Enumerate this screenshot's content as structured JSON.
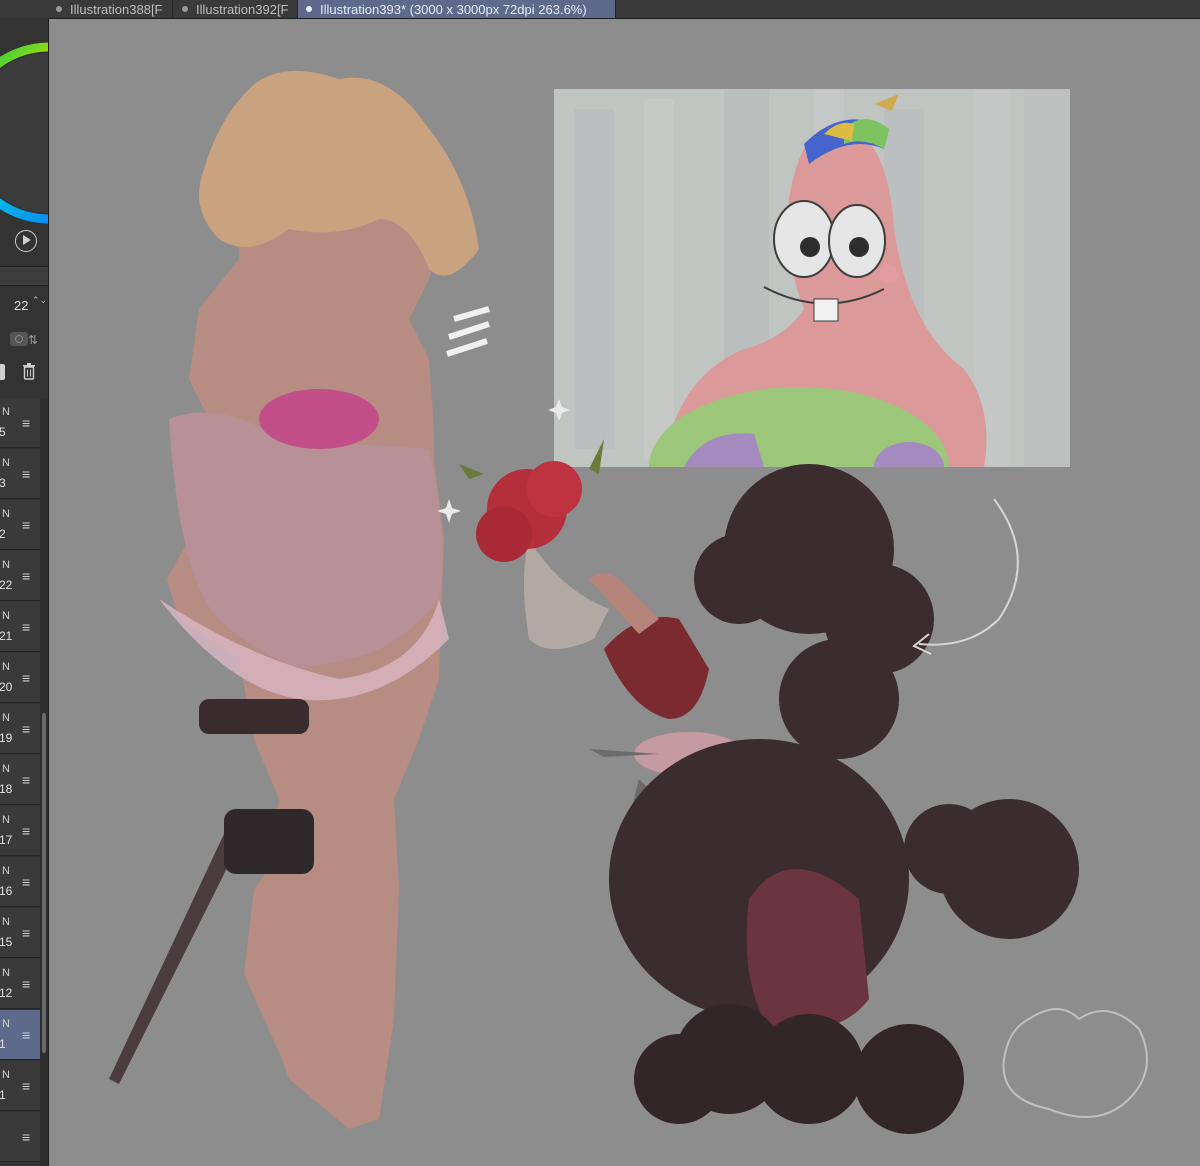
{
  "tabs": [
    {
      "label": "Illustration388[F",
      "active": false
    },
    {
      "label": "Illustration392[F",
      "active": false
    },
    {
      "label": "Illustration393* (3000 x 3000px 72dpi 263.6%)",
      "active": true
    }
  ],
  "toolbar": {
    "size_value": "22",
    "size_stepper": "⌃⌄"
  },
  "layers": [
    {
      "tag": "N",
      "num": "5",
      "menu": "≡",
      "selected": false
    },
    {
      "tag": "N",
      "num": "3",
      "menu": "≡",
      "selected": false
    },
    {
      "tag": "N",
      "num": "2",
      "menu": "≡",
      "selected": false
    },
    {
      "tag": "N",
      "num": "22",
      "menu": "≡",
      "selected": false
    },
    {
      "tag": "N",
      "num": "21",
      "menu": "≡",
      "selected": false
    },
    {
      "tag": "N",
      "num": "20",
      "menu": "≡",
      "selected": false
    },
    {
      "tag": "N",
      "num": "19",
      "menu": "≡",
      "selected": false
    },
    {
      "tag": "N",
      "num": "18",
      "menu": "≡",
      "selected": false
    },
    {
      "tag": "N",
      "num": "17",
      "menu": "≡",
      "selected": false
    },
    {
      "tag": "N",
      "num": "16",
      "menu": "≡",
      "selected": false
    },
    {
      "tag": "N",
      "num": "15",
      "menu": "≡",
      "selected": false
    },
    {
      "tag": "N",
      "num": "12",
      "menu": "≡",
      "selected": false
    },
    {
      "tag": "N",
      "num": "1",
      "menu": "≡",
      "selected": true
    },
    {
      "tag": "N",
      "num": "1",
      "menu": "≡",
      "selected": false
    },
    {
      "tag": "",
      "num": "",
      "menu": "≡",
      "selected": false
    }
  ],
  "colors": {
    "canvas_bg": "#8d8d8d",
    "active_tab": "#5d6a8c",
    "panel_bg": "#333333"
  },
  "icons": [
    "color-wheel-icon",
    "play-icon",
    "stepper-icon",
    "lock-icon",
    "trash-icon",
    "layer-menu-icon"
  ]
}
